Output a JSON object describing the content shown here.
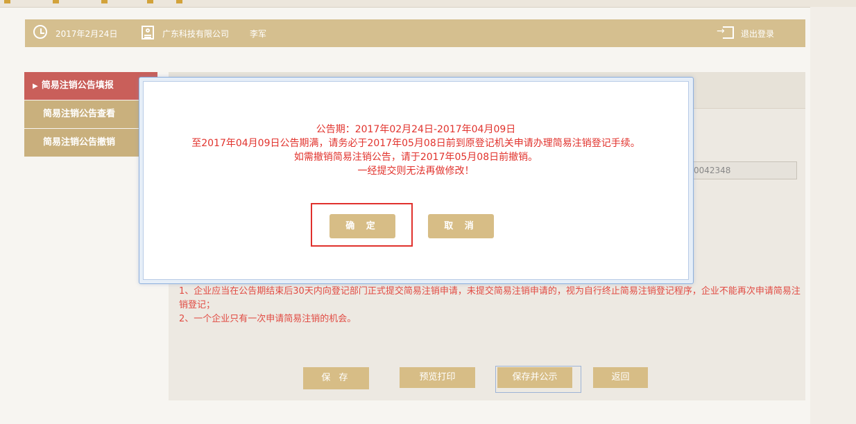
{
  "header": {
    "date": "2017年2月24日",
    "company": "广东科技有限公司",
    "user": "李军",
    "logout_label": "退出登录"
  },
  "sidebar": {
    "items": [
      {
        "label": "简易注销公告填报",
        "active": true
      },
      {
        "label": "简易注销公告查看",
        "active": false
      },
      {
        "label": "简易注销公告撤销",
        "active": false
      }
    ]
  },
  "main": {
    "registration_no": "0042348",
    "notes": [
      "1、企业应当在公告期结束后30天内向登记部门正式提交简易注销申请，未提交简易注销申请的，视为自行终止简易注销登记程序，企业不能再次申请简易注销登记；",
      "2、一个企业只有一次申请简易注销的机会。"
    ],
    "buttons": {
      "save": "保 存",
      "preview": "预览打印",
      "save_publish": "保存并公示",
      "back": "返回"
    }
  },
  "dialog": {
    "lines": [
      "公告期：2017年02月24日-2017年04月09日",
      "至2017年04月09日公告期满，请务必于2017年05月08日前到原登记机关申请办理简易注销登记手续。",
      "如需撤销简易注销公告，请于2017年05月08日前撤销。",
      "一经提交则无法再做修改！"
    ],
    "ok_label": "确 定",
    "cancel_label": "取 消"
  },
  "colors": {
    "gold": "#d5bf8f",
    "button": "#d7bd86",
    "active_nav": "#c95f5a",
    "warning_text": "#e1322c"
  }
}
